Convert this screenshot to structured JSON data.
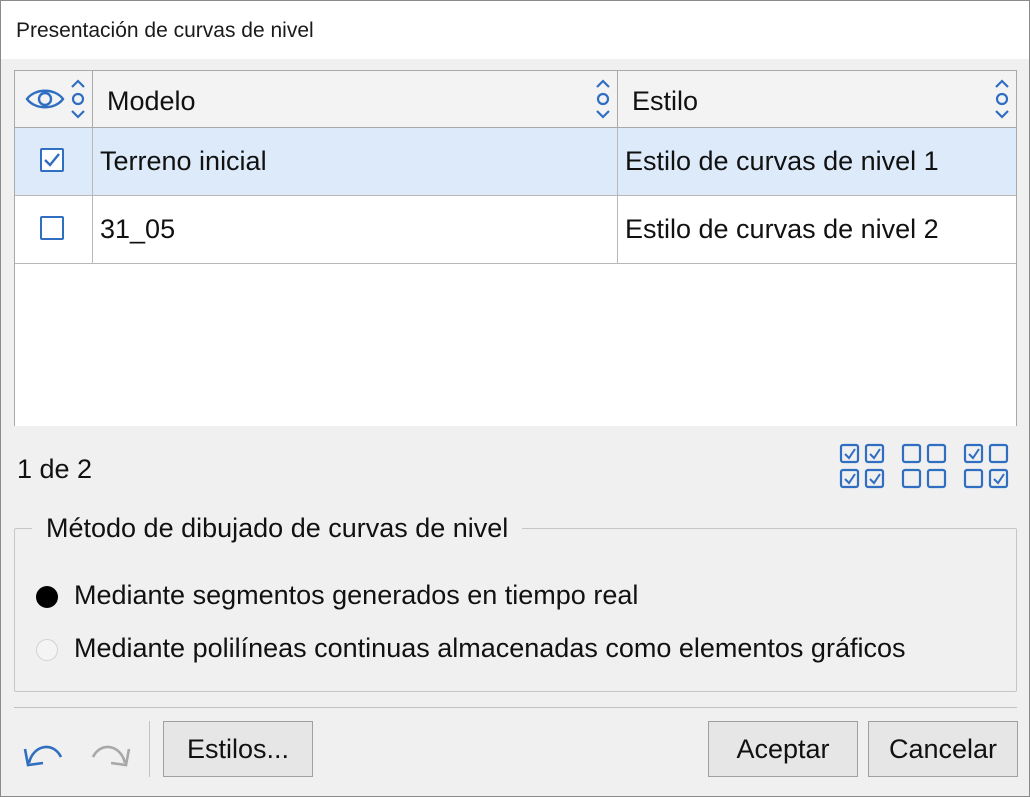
{
  "window": {
    "title": "Presentación de curvas de nivel"
  },
  "grid": {
    "columns": [
      {
        "id": "visible",
        "label": "",
        "icon": "eye-icon"
      },
      {
        "id": "model",
        "label": "Modelo"
      },
      {
        "id": "style",
        "label": "Estilo"
      }
    ],
    "rows": [
      {
        "checked": true,
        "selected": true,
        "model": "Terreno inicial",
        "style": "Estilo de curvas de nivel 1"
      },
      {
        "checked": false,
        "selected": false,
        "model": "31_05",
        "style": "Estilo de curvas de nivel 2"
      }
    ],
    "counter": "1 de 2",
    "bulk_icons": [
      "check-all-icon",
      "uncheck-all-icon",
      "invert-selection-icon"
    ]
  },
  "method": {
    "legend": "Método de dibujado de curvas de nivel",
    "options": [
      {
        "label": "Mediante segmentos generados en tiempo real",
        "selected": true
      },
      {
        "label": "Mediante polilíneas continuas almacenadas como elementos gráficos",
        "selected": false
      }
    ]
  },
  "footer": {
    "undo_icon": "undo-icon",
    "redo_icon": "redo-icon",
    "styles_label": "Estilos...",
    "accept_label": "Aceptar",
    "cancel_label": "Cancelar"
  },
  "colors": {
    "accent": "#2f6ec0",
    "selected_row": "#dceaf9",
    "window_bg": "#f0f0f0"
  }
}
